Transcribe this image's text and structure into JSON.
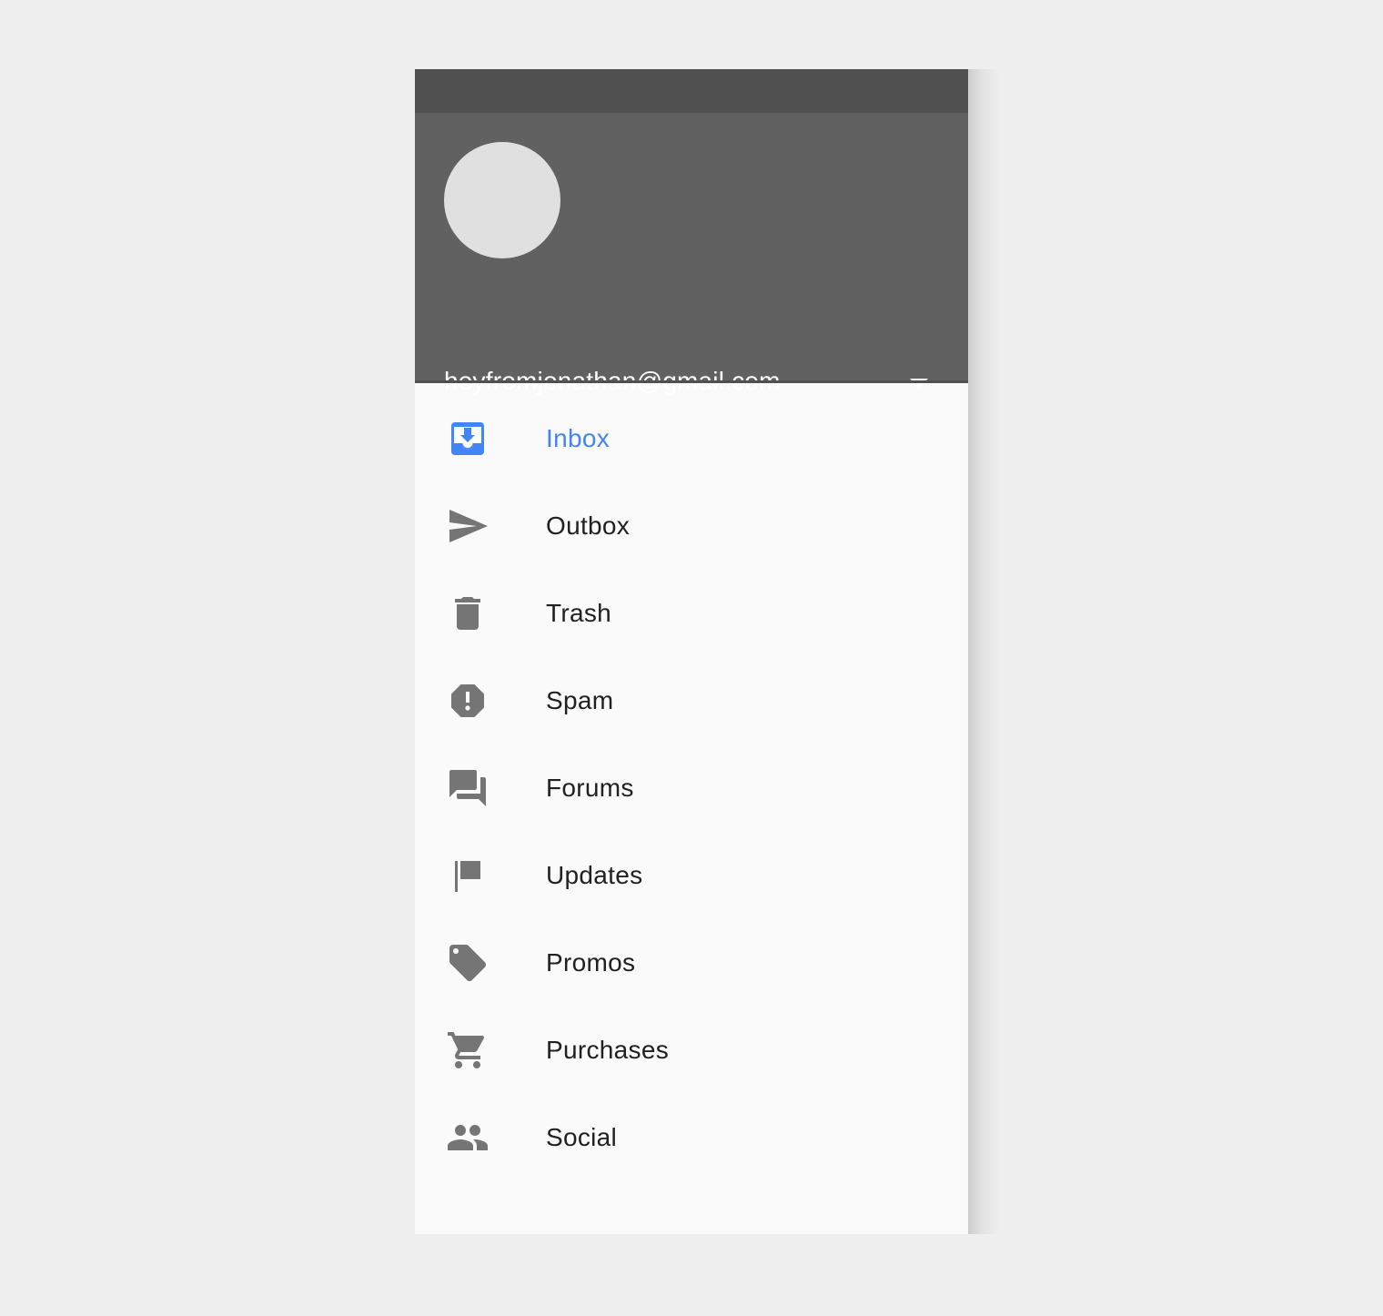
{
  "account": {
    "email": "heyfromjonathan@gmail.com",
    "avatar": "avatar-placeholder",
    "dropdown_icon": "arrow-drop-down-icon"
  },
  "colors": {
    "accent": "#4285f4",
    "header_bg": "#616161",
    "status_bar_bg": "#505050",
    "icon_gray": "#757575",
    "drawer_bg": "#fafafa",
    "page_bg": "#eeeeee"
  },
  "nav": {
    "active": "Inbox",
    "items": [
      {
        "label": "Inbox",
        "icon": "inbox-icon"
      },
      {
        "label": "Outbox",
        "icon": "send-icon"
      },
      {
        "label": "Trash",
        "icon": "trash-icon"
      },
      {
        "label": "Spam",
        "icon": "spam-icon"
      },
      {
        "label": "Forums",
        "icon": "forum-icon"
      },
      {
        "label": "Updates",
        "icon": "flag-icon"
      },
      {
        "label": "Promos",
        "icon": "tag-icon"
      },
      {
        "label": "Purchases",
        "icon": "cart-icon"
      },
      {
        "label": "Social",
        "icon": "people-icon"
      }
    ]
  }
}
